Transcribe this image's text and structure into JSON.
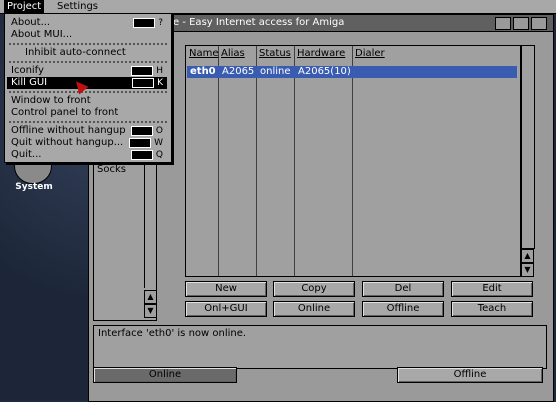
{
  "screenbar": {
    "menus": [
      "Project",
      "Settings"
    ]
  },
  "system_icon": {
    "label": "System"
  },
  "window": {
    "title": "e - Easy Internet access for Amiga",
    "left_list": {
      "items": [
        "Socks"
      ]
    },
    "table": {
      "headers": [
        "Name",
        "Alias",
        "Status",
        "Hardware",
        "Dialer"
      ],
      "rows": [
        [
          "eth0",
          "A2065",
          "online",
          "A2065(10)",
          ""
        ]
      ]
    },
    "buttons": {
      "row1": [
        "New",
        "Copy",
        "Del",
        "Edit"
      ],
      "row2": [
        "Onl+GUI",
        "Online",
        "Offline",
        "Teach"
      ]
    },
    "log": "Interface 'eth0' is now online.",
    "footer": {
      "left": "Online",
      "right": "Offline"
    }
  },
  "menu": {
    "items": [
      {
        "label": "About...",
        "shortcut": "?"
      },
      {
        "label": "About MUI...",
        "shortcut": ""
      },
      {
        "label": "Inhibit auto-connect",
        "shortcut": ""
      },
      {
        "label": "Iconify",
        "shortcut": "H"
      },
      {
        "label": "Kill GUI",
        "shortcut": "K"
      },
      {
        "label": "Window to front",
        "shortcut": ""
      },
      {
        "label": "Control panel to front",
        "shortcut": ""
      },
      {
        "label": "Offline without hangup",
        "shortcut": "O"
      },
      {
        "label": "Quit without hangup...",
        "shortcut": "W"
      },
      {
        "label": "Quit...",
        "shortcut": "Q"
      }
    ]
  }
}
